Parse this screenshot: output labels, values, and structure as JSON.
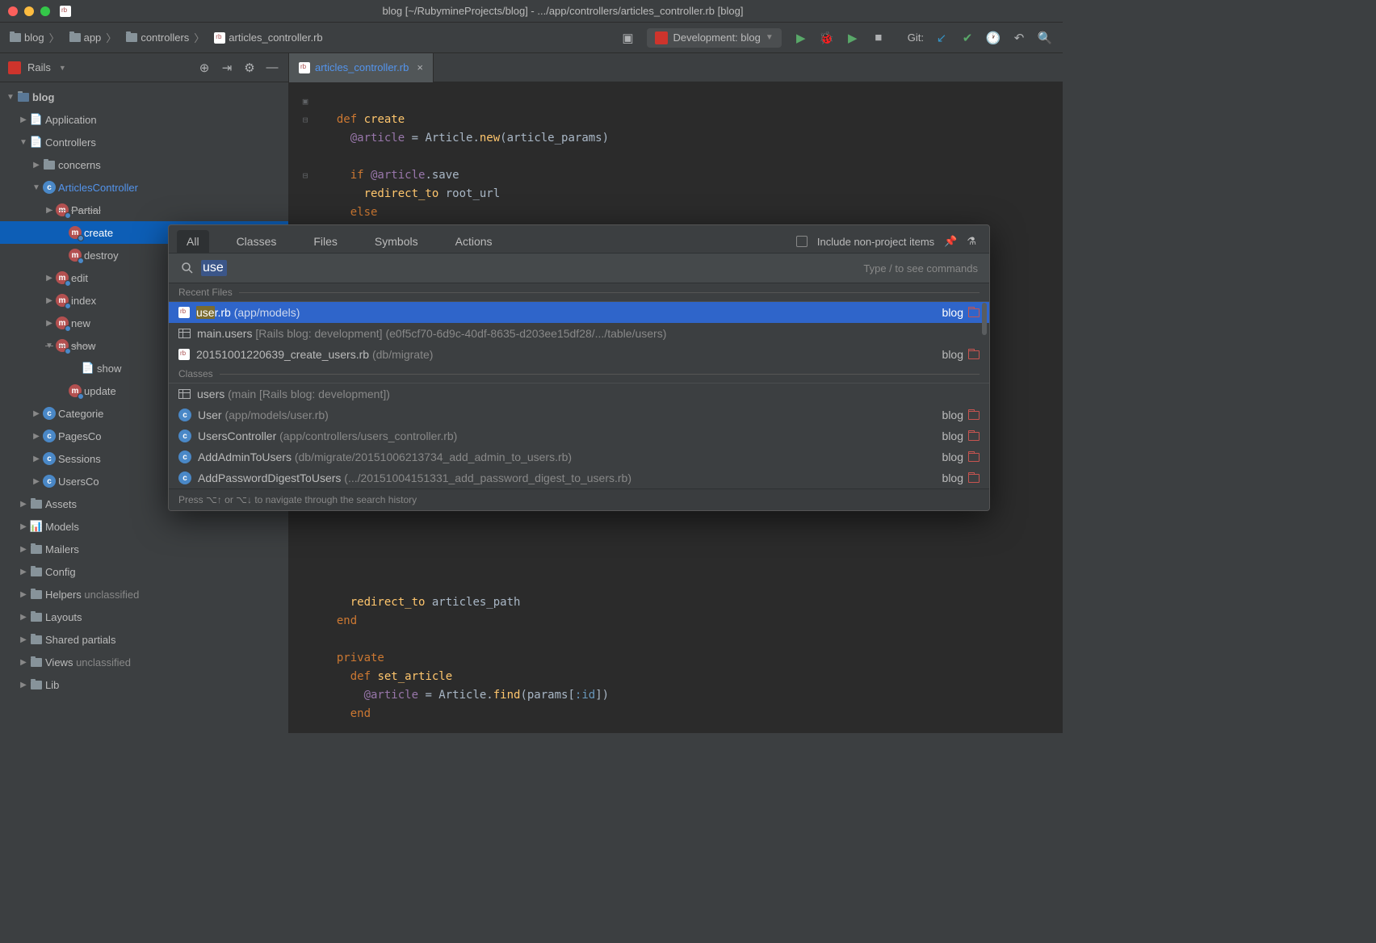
{
  "window": {
    "title": "blog [~/RubymineProjects/blog] - .../app/controllers/articles_controller.rb [blog]"
  },
  "breadcrumbs": {
    "items": [
      "blog",
      "app",
      "controllers",
      "articles_controller.rb"
    ]
  },
  "runconfig": {
    "label": "Development: blog"
  },
  "git_label": "Git:",
  "sidebar": {
    "header": "Rails",
    "tree": {
      "root": "blog",
      "application": "Application",
      "controllers": "Controllers",
      "concerns": "concerns",
      "articles_controller": "ArticlesController",
      "partial": "Partial",
      "create": "create",
      "destroy": "destroy",
      "edit": "edit",
      "index": "index",
      "new": "new",
      "show": "show",
      "show_child": "show",
      "update": "update",
      "categories": "Categorie",
      "pages": "PagesCo",
      "sessions": "Sessions",
      "users": "UsersCo",
      "assets": "Assets",
      "models": "Models",
      "mailers": "Mailers",
      "config": "Config",
      "helpers": "Helpers",
      "helpers_note": "unclassified",
      "layouts": "Layouts",
      "shared_partials": "Shared partials",
      "views": "Views",
      "views_note": "unclassified",
      "lib": "Lib"
    }
  },
  "tabs": {
    "active": "articles_controller.rb"
  },
  "code": {
    "l1a": "def",
    "l1b": "create",
    "l2a": "@article",
    "l2b": " = Article.",
    "l2c": "new",
    "l2d": "(article_params)",
    "l3a": "if",
    "l3b": " @article",
    "l3c": ".save",
    "l4a": "redirect_to",
    "l4b": " root_url",
    "l5": "else",
    "l20a": "    redirect_to",
    "l20b": " articles_path",
    "l21": "  end",
    "l22": "  private",
    "l23a": "    def",
    "l23b": " set_article",
    "l24a": "      @article",
    "l24b": " = Article.",
    "l24c": "find",
    "l24d": "(params[",
    "l24e": ":id",
    "l24f": "])",
    "l25": "    end"
  },
  "search": {
    "tabs": [
      "All",
      "Classes",
      "Files",
      "Symbols",
      "Actions"
    ],
    "include_label": "Include non-project items",
    "query": "use",
    "placeholder_hint": "Type / to see commands",
    "sections": {
      "recent": "Recent Files",
      "classes": "Classes"
    },
    "results": {
      "r1_hl": "use",
      "r1_rest": "r.rb",
      "r1_path": "(app/models)",
      "r1_right": "blog",
      "r2": "main.users",
      "r2_path": "[Rails blog: development]",
      "r2_path2": "(e0f5cf70-6d9c-40df-8635-d203ee15df28/.../table/users)",
      "r3": "20151001220639_create_users.rb",
      "r3_path": "(db/migrate)",
      "r3_right": "blog",
      "r4": "users",
      "r4_path": "(main [Rails blog: development])",
      "r5": "User",
      "r5_path": "(app/models/user.rb)",
      "r5_right": "blog",
      "r6": "UsersController",
      "r6_path": "(app/controllers/users_controller.rb)",
      "r6_right": "blog",
      "r7": "AddAdminToUsers",
      "r7_path": "(db/migrate/20151006213734_add_admin_to_users.rb)",
      "r7_right": "blog",
      "r8": "AddPasswordDigestToUsers",
      "r8_path": "(.../20151004151331_add_password_digest_to_users.rb)",
      "r8_right": "blog"
    },
    "footer": "Press ⌥↑ or ⌥↓ to navigate through the search history"
  }
}
